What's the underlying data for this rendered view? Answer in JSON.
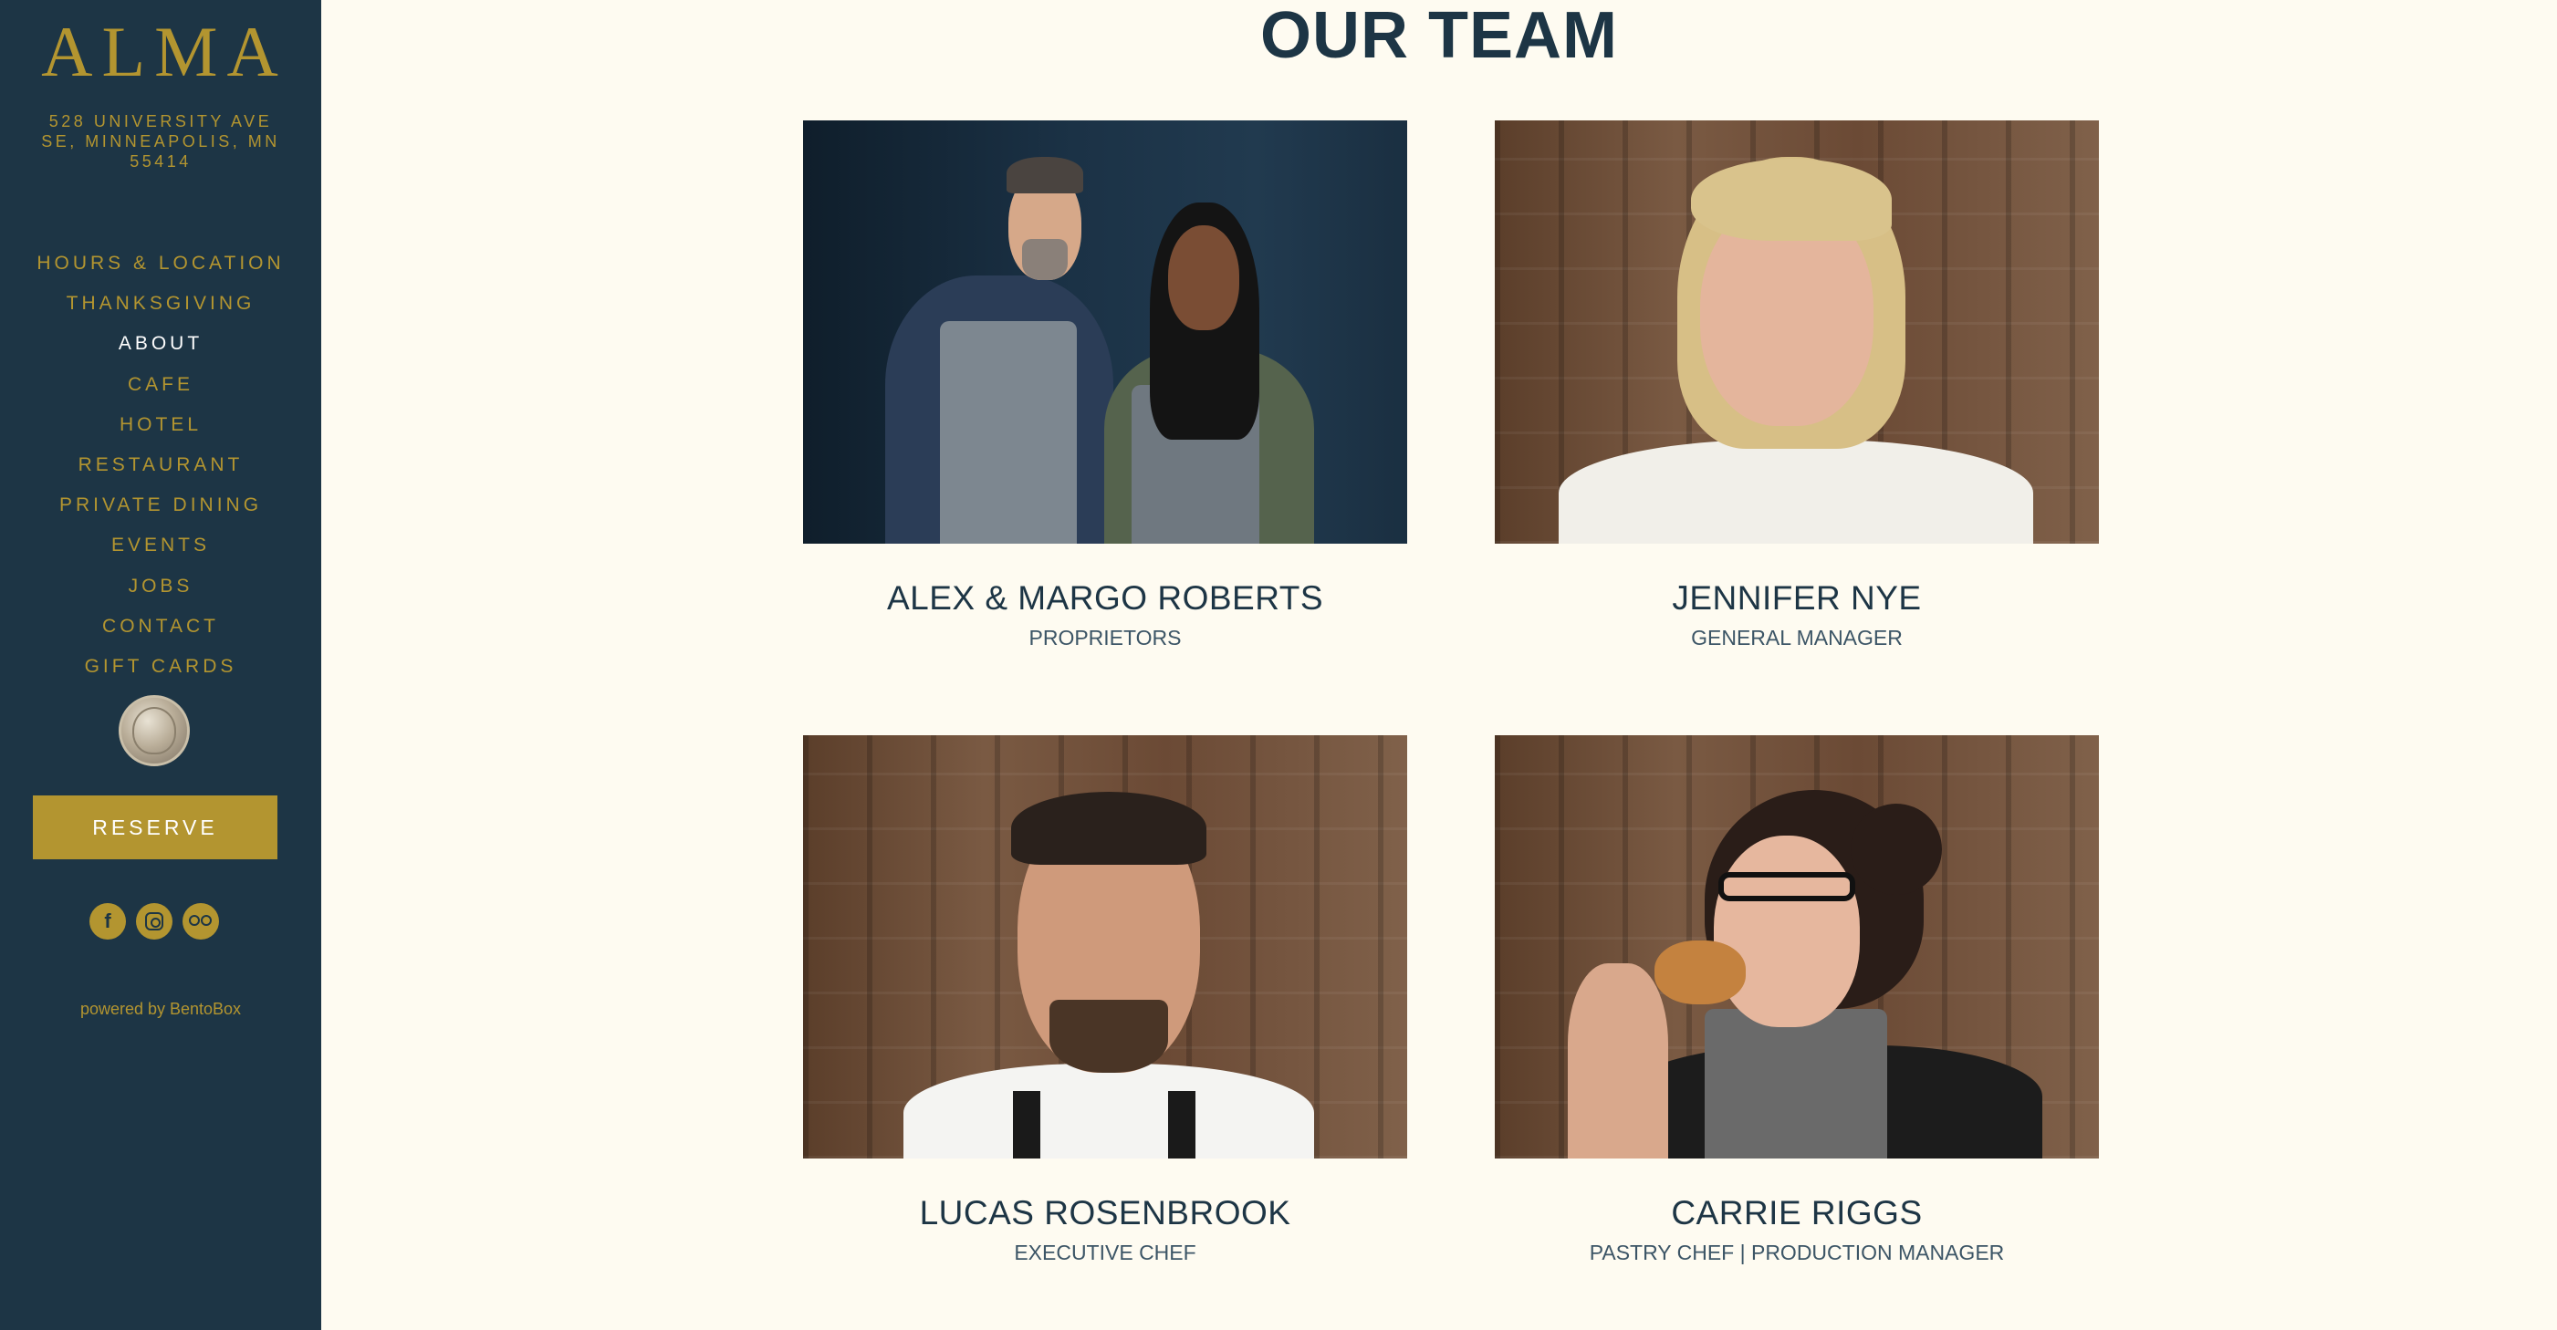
{
  "sidebar": {
    "logo": "ALMA",
    "address": "528 UNIVERSITY AVE SE, MINNEAPOLIS, MN 55414",
    "nav": [
      {
        "label": "HOURS & LOCATION",
        "active": false
      },
      {
        "label": "THANKSGIVING",
        "active": false
      },
      {
        "label": "ABOUT",
        "active": true
      },
      {
        "label": "CAFE",
        "active": false
      },
      {
        "label": "HOTEL",
        "active": false
      },
      {
        "label": "RESTAURANT",
        "active": false
      },
      {
        "label": "PRIVATE DINING",
        "active": false
      },
      {
        "label": "EVENTS",
        "active": false
      },
      {
        "label": "JOBS",
        "active": false
      },
      {
        "label": "CONTACT",
        "active": false
      },
      {
        "label": "GIFT CARDS",
        "active": false
      }
    ],
    "reserve_label": "RESERVE",
    "social": [
      "facebook-icon",
      "instagram-icon",
      "tripadvisor-icon"
    ],
    "powered_by": "powered by BentoBox"
  },
  "main": {
    "title": "OUR TEAM",
    "team": [
      {
        "name": "ALEX & MARGO ROBERTS",
        "role": "PROPRIETORS"
      },
      {
        "name": "JENNIFER NYE",
        "role": "GENERAL MANAGER"
      },
      {
        "name": "LUCAS ROSENBROOK",
        "role": "EXECUTIVE CHEF"
      },
      {
        "name": "CARRIE RIGGS",
        "role": "PASTRY CHEF | PRODUCTION MANAGER"
      }
    ]
  },
  "colors": {
    "sidebar_bg": "#1d3545",
    "accent_gold": "#b39530",
    "page_bg": "#fefbf1",
    "heading_text": "#1d3545"
  }
}
